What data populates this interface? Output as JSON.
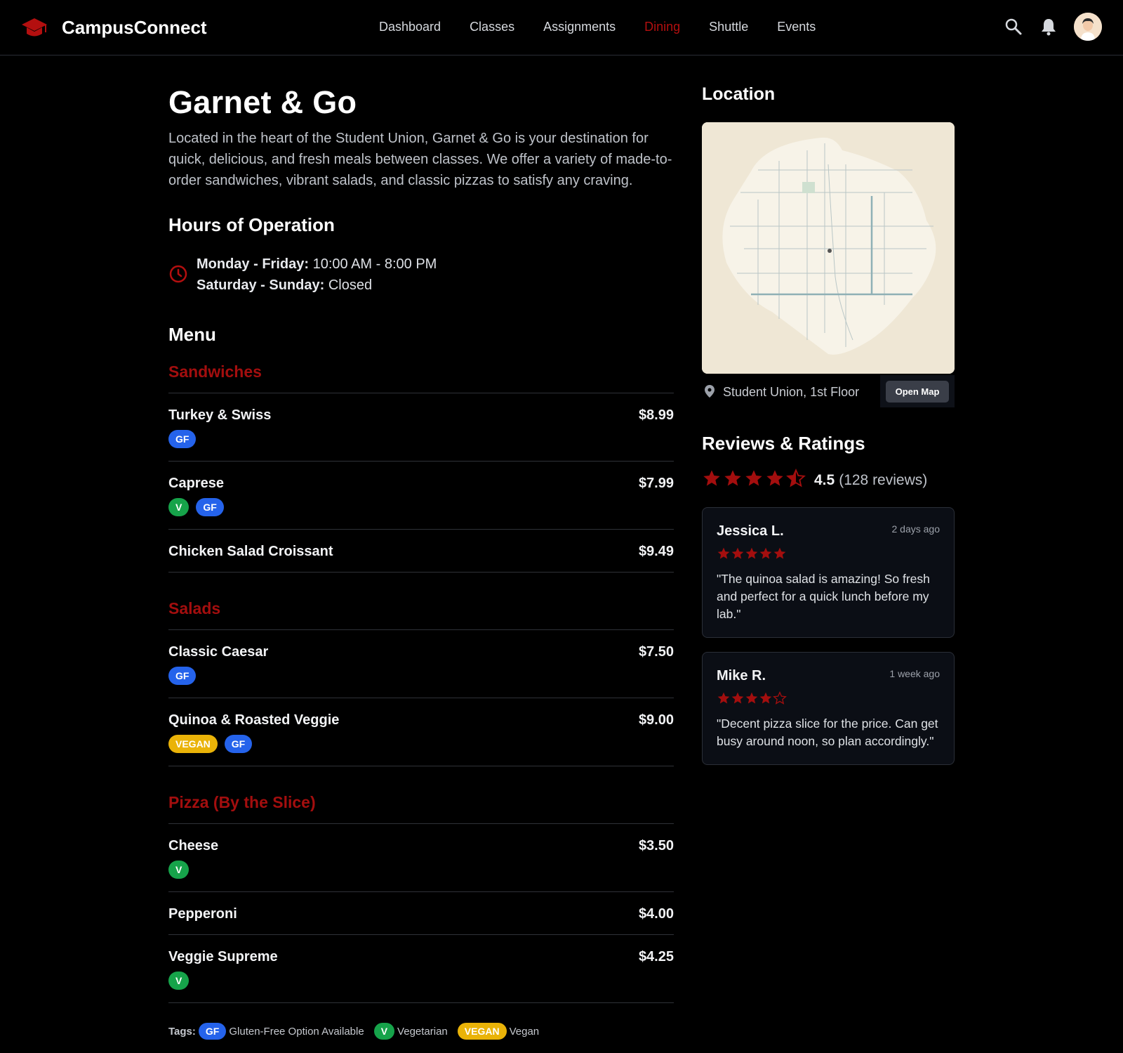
{
  "app": {
    "name": "CampusConnect"
  },
  "nav": {
    "items": [
      {
        "label": "Dashboard"
      },
      {
        "label": "Classes"
      },
      {
        "label": "Assignments"
      },
      {
        "label": "Dining",
        "active": true
      },
      {
        "label": "Shuttle"
      },
      {
        "label": "Events"
      }
    ]
  },
  "header_icons": [
    "search-icon",
    "bell-icon",
    "avatar"
  ],
  "colors": {
    "accent": "#b30f0f",
    "gf": "#2563eb",
    "v": "#16a34a",
    "vegan": "#eab308",
    "star": "#a30e0e"
  },
  "venue": {
    "title": "Garnet & Go",
    "description": "Located in the heart of the Student Union, Garnet & Go is your destination for quick, delicious, and fresh meals between classes. We offer a variety of made-to-order sandwiches, vibrant salads, and classic pizzas to satisfy any craving."
  },
  "hours": {
    "title": "Hours of Operation",
    "weekday_label": "Monday - Friday:",
    "weekday_value": " 10:00 AM - 8:00 PM",
    "weekend_label": "Saturday - Sunday:",
    "weekend_value": " Closed"
  },
  "menu": {
    "title": "Menu",
    "categories": [
      {
        "name": "Sandwiches",
        "items": [
          {
            "name": "Turkey & Swiss",
            "price": "$8.99",
            "tags": [
              "GF"
            ]
          },
          {
            "name": "Caprese",
            "price": "$7.99",
            "tags": [
              "V",
              "GF"
            ]
          },
          {
            "name": "Chicken Salad Croissant",
            "price": "$9.49",
            "tags": []
          }
        ]
      },
      {
        "name": "Salads",
        "items": [
          {
            "name": "Classic Caesar",
            "price": "$7.50",
            "tags": [
              "GF"
            ]
          },
          {
            "name": "Quinoa & Roasted Veggie",
            "price": "$9.00",
            "tags": [
              "VEGAN",
              "GF"
            ]
          }
        ]
      },
      {
        "name": "Pizza (By the Slice)",
        "items": [
          {
            "name": "Cheese",
            "price": "$3.50",
            "tags": [
              "V"
            ]
          },
          {
            "name": "Pepperoni",
            "price": "$4.00",
            "tags": []
          },
          {
            "name": "Veggie Supreme",
            "price": "$4.25",
            "tags": [
              "V"
            ]
          }
        ]
      }
    ],
    "legend": {
      "label": "Tags:",
      "entries": [
        {
          "tag": "GF",
          "text": "Gluten-Free Option Available"
        },
        {
          "tag": "V",
          "text": "Vegetarian"
        },
        {
          "tag": "VEGAN",
          "text": "Vegan"
        }
      ]
    }
  },
  "location": {
    "title": "Location",
    "address": "Student Union, 1st Floor",
    "open_map_label": "Open Map"
  },
  "reviews": {
    "title": "Reviews & Ratings",
    "average": "4.5",
    "average_value": 4.5,
    "count_text": "(128 reviews)",
    "items": [
      {
        "author": "Jessica L.",
        "time": "2 days ago",
        "rating": 5,
        "text": "\"The quinoa salad is amazing! So fresh and perfect for a quick lunch before my lab.\""
      },
      {
        "author": "Mike R.",
        "time": "1 week ago",
        "rating": 4,
        "text": "\"Decent pizza slice for the price. Can get busy around noon, so plan accordingly.\""
      }
    ]
  }
}
